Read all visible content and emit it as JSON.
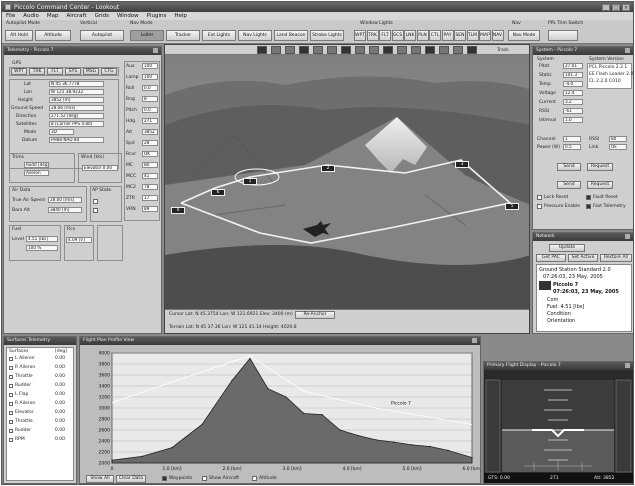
{
  "app": {
    "title": "Piccolo Command Center - Lookout",
    "window_controls": [
      "_",
      "□",
      "×"
    ]
  },
  "menu": [
    "File",
    "Audio",
    "Map",
    "Aircraft",
    "Grids",
    "Window",
    "Plugins",
    "Help"
  ],
  "toolbar": {
    "groups": [
      "Autopilot Mode",
      "Vertical",
      "Nav Mode",
      "Window Lights",
      "Nav",
      "PPL Trim Switch"
    ],
    "buttons": [
      "Alt Hold",
      "Altitude",
      "Autopilot",
      "Loiter",
      "Tracker",
      "Ext Lights",
      "Nav Lights",
      "Land Beacon",
      "Strobe Lights",
      "Nav Mode"
    ],
    "window_buttons": [
      "WPT",
      "TRK",
      "FLT",
      "GCS",
      "LNK",
      "PLN",
      "CTL",
      "PAY",
      "SEN",
      "TLM",
      "MAP",
      "NAV"
    ]
  },
  "telemetry": {
    "title": "Telemetry - Piccolo 7",
    "mode_buttons": [
      "WPT",
      "TRK",
      "FLT",
      "SYS",
      "MSG",
      "CFG"
    ],
    "labels": {
      "gps": "GPS",
      "lat": "Lat",
      "lon": "Lon",
      "height": "Height",
      "ground_speed": "Ground Speed",
      "direction": "Direction",
      "satellites": "Satellites",
      "mode": "Mode",
      "datum": "Datum",
      "trims": "Trims",
      "wind": "Wind (kts)",
      "ap": "AP State",
      "air_data": "Air Data",
      "tas": "True Air Speed",
      "baro": "Baro Alt",
      "fuel": "Fuel",
      "level": "Level",
      "rcv": "Rcv"
    },
    "values": {
      "lat": "N 45 36.7778",
      "lon": "W 121 38.9232",
      "height": "3852 [m]",
      "ground_speed": "28.06 [m/s]",
      "direction": "271.52 [deg]",
      "satellites": "8 (Carrier PPS 4.80)",
      "mode": "3D",
      "datum": "PH88 NAD 84",
      "trims_a": "Rudd [deg]",
      "trims_b": "Aileron",
      "wind": "Elevator 0.00",
      "tas": "28.00 [m/s]",
      "baro": "3840 [m]",
      "fuel": "4.51 [lbs]",
      "level": "100 %",
      "rcv": "4.09 [V]"
    },
    "right_list": [
      "Aux",
      "Lamp",
      "Roll",
      "Rng",
      "Pitch",
      "Hdg",
      "Alt",
      "Spd",
      "Rcvr",
      "MC",
      "MCC",
      "MC2",
      "ZTR",
      "VRN"
    ],
    "right_vals": [
      "100",
      "100",
      "0.0",
      "8",
      "0.0",
      "271",
      "3852",
      "28",
      "OK",
      "80",
      "41",
      "78",
      "17",
      "89"
    ]
  },
  "view": {
    "toolbar_icons": [
      "target-icon",
      "globe-icon",
      "plane-icon",
      "camera-icon",
      "zoom-icon",
      "pan-icon",
      "grid-icon",
      "layers-icon",
      "flag-icon",
      "waypoint-icon",
      "ruler-icon",
      "lock-icon",
      "pointer-icon",
      "rotate-icon",
      "close-icon",
      "settings-icon"
    ],
    "track_label": "Track",
    "waypoints": [
      "0",
      "6",
      "1",
      "2",
      "3",
      "5"
    ],
    "status_line": "Cursor Lat: N 45.3754 Lon: W 121.6921 Elev: 3400 (m)",
    "status_btn": "Re-Anchor",
    "status_line2": "Terrain Lat: N 45 37.36 Lon: W 121 41.14 Height: 4020.8"
  },
  "system": {
    "title": "System - Piccolo 7",
    "section_left": "System",
    "section_right": "System Version",
    "rows": [
      "Pitot",
      "Static",
      "Temp",
      "Voltage",
      "Current",
      "RSSI",
      "Interval"
    ],
    "row_vals": [
      "27.01",
      "101.3",
      "-4.0",
      "12.4",
      "3.2",
      "-61",
      "1.0"
    ],
    "version": [
      "PCL Piccolo 2.2.1",
      "EE Flash Loader 2.0",
      "CL 2.2.0 C010"
    ],
    "channel": "Channel",
    "power": "Power (W)",
    "rssi": "RSSI",
    "link": "Link",
    "channel_vals": [
      "1",
      "0.5"
    ],
    "rssi_vals": [
      "80",
      "Ok"
    ],
    "btn_send": "Send",
    "btn_request": "Request",
    "btn_send2": "Send",
    "btn_request2": "Request",
    "checks": [
      "Lock Reset",
      "Fault Reset",
      "Pressure Enable",
      "Fast Telemetry"
    ]
  },
  "network": {
    "title": "Network",
    "top_btn": "Update",
    "btns": [
      "Get PAC",
      "Set Active",
      "Restore All"
    ],
    "items": [
      "Ground Station Standard 2.0",
      "07:26:03, 23 May, 2005",
      "Piccolo 7",
      "07:26:03, 23 May, 2005",
      "Com",
      "Fuel: 4.51 [lbs]",
      "Condition",
      "Orientation"
    ]
  },
  "surfaces": {
    "title": "Surfaces Telemetry",
    "header": [
      "Surfaces",
      "[deg]"
    ],
    "rows": [
      "L Aileron",
      "R Aileron",
      "Throttle",
      "Rudder",
      "L Flap",
      "R Aileron",
      "Elevator",
      "Throttle",
      "Rudder",
      "RPM"
    ],
    "vals": [
      "0.00",
      "0.00",
      "0.00",
      "0.00",
      "0.00",
      "0.00",
      "0.00",
      "0.00",
      "0.00",
      "0.00"
    ]
  },
  "profile": {
    "title": "Flight Plan Profile View",
    "y_ticks": [
      "4000",
      "3800",
      "3600",
      "3400",
      "3200",
      "3000",
      "2800",
      "2600",
      "2400",
      "2200",
      "2000"
    ],
    "x_ticks": [
      "0",
      "1.0 [km]",
      "2.0 [km]",
      "3.0 [km]",
      "4.0 [km]",
      "5.0 [km]",
      "6.0 [km]"
    ],
    "btns": [
      "Show All",
      "Clear Data"
    ],
    "checks": [
      "Waypoints",
      "Show Aircraft",
      "Altitude"
    ],
    "aircraft_label": "Piccolo 7"
  },
  "pfd": {
    "title": "Primary Flight Display - Piccolo 7",
    "bottom_left": "GTS: 0.00",
    "bottom_right": "Alt: 3852",
    "bottom_mid": "271"
  },
  "chart_data": {
    "type": "area",
    "x": [
      0,
      0.5,
      1.0,
      1.5,
      2.0,
      2.3,
      2.6,
      2.9,
      3.2,
      3.5,
      3.8,
      4.1,
      4.4,
      4.7,
      5.0,
      5.3,
      5.6,
      6.0
    ],
    "values": [
      2050,
      2120,
      2280,
      2700,
      3500,
      3900,
      3350,
      3200,
      2900,
      2880,
      2600,
      2500,
      2420,
      2380,
      2330,
      2300,
      2230,
      2100
    ],
    "xlabel": "",
    "ylabel": "",
    "ylim": [
      2000,
      4000
    ]
  }
}
